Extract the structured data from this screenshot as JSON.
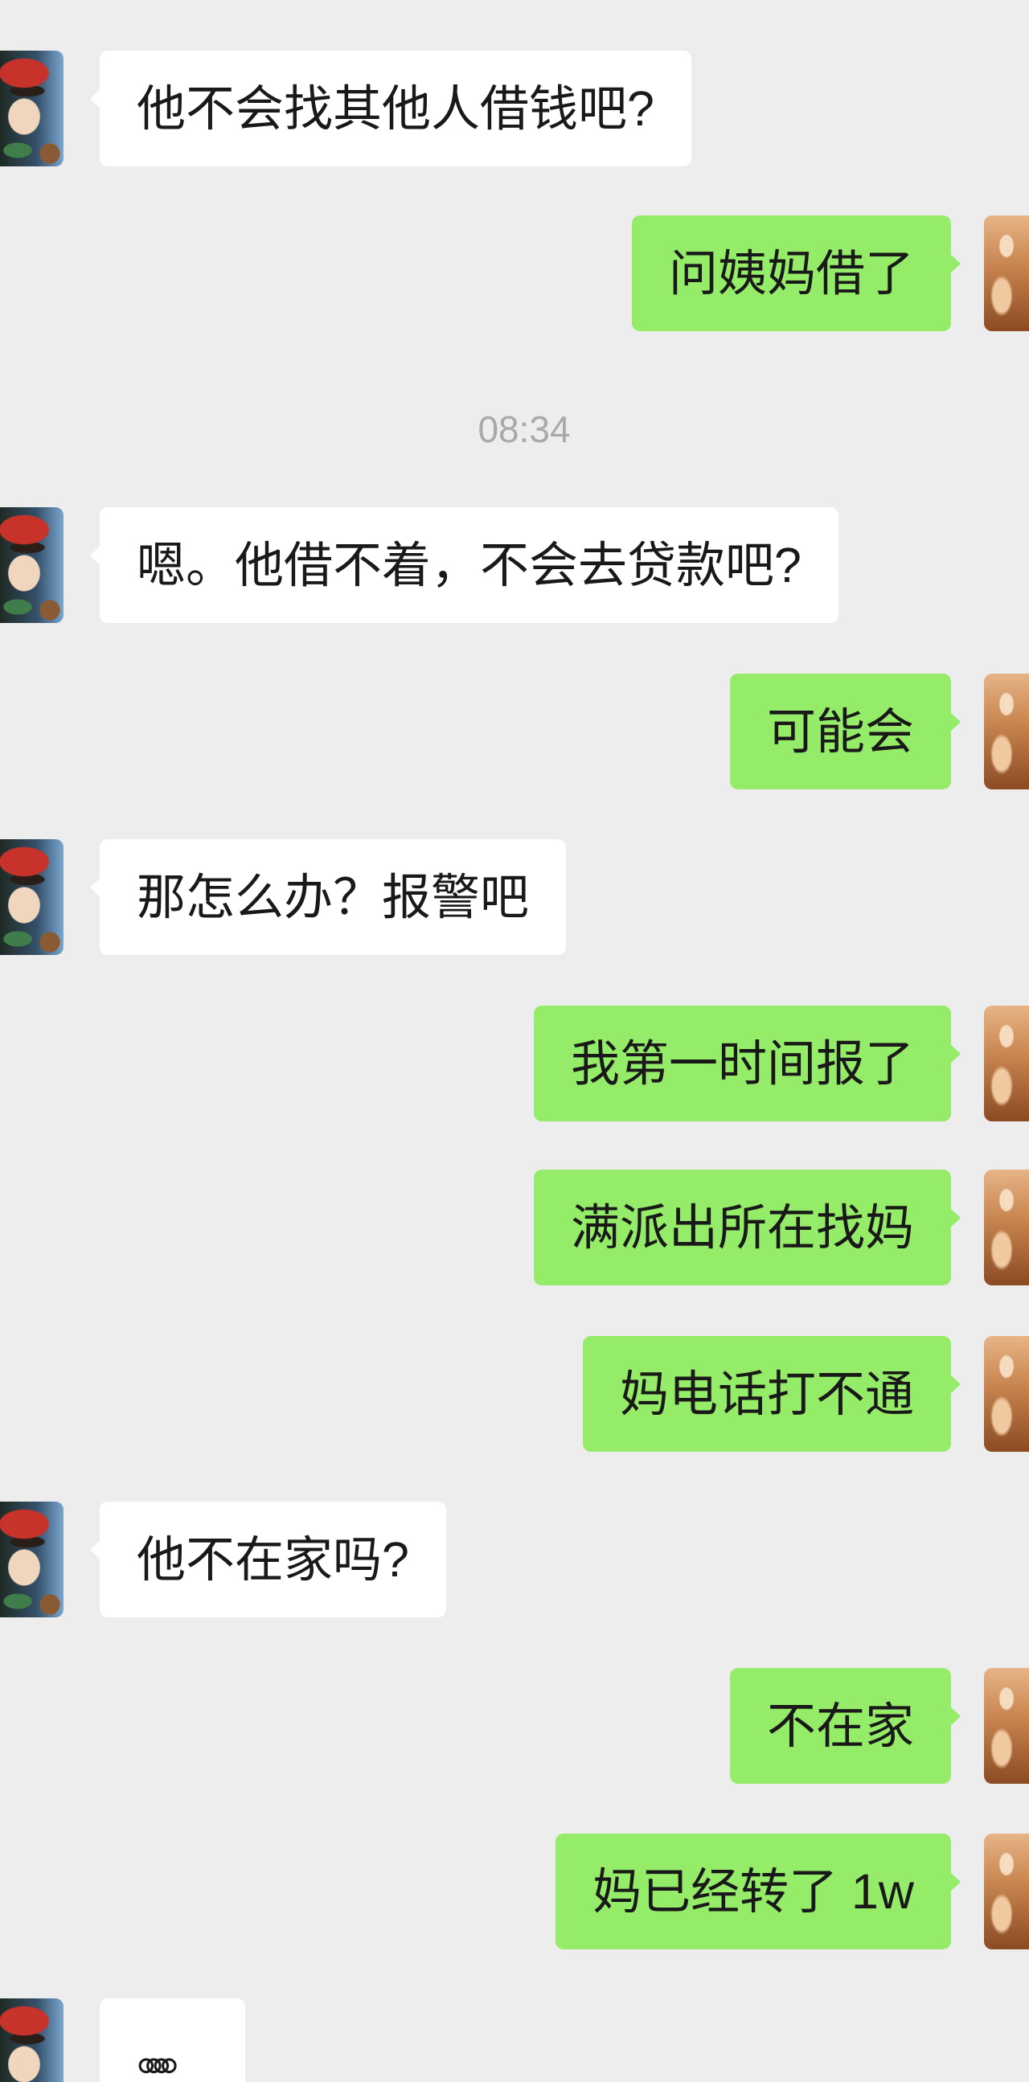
{
  "colors": {
    "background": "#ededed",
    "sent_bubble": "#95ec69",
    "received_bubble": "#ffffff",
    "message_text": "#191919",
    "timestamp": "#a9a9a9"
  },
  "icons": {
    "contact_avatar": "contact-avatar",
    "my_avatar": "my-avatar"
  },
  "timestamp": "08:34",
  "messages": [
    {
      "text": "他不会找其他人借钱吧?",
      "outgoing": false
    },
    {
      "text": "问姨妈借了",
      "outgoing": true
    },
    {
      "text": "嗯。他借不着，不会去贷款吧?",
      "outgoing": false
    },
    {
      "text": "可能会",
      "outgoing": true
    },
    {
      "text": "那怎么办？报警吧",
      "outgoing": false
    },
    {
      "text": "我第一时间报了",
      "outgoing": true
    },
    {
      "text": "满派出所在找妈",
      "outgoing": true
    },
    {
      "text": "妈电话打不通",
      "outgoing": true
    },
    {
      "text": "他不在家吗?",
      "outgoing": false
    },
    {
      "text": "不在家",
      "outgoing": true
    },
    {
      "text": "妈已经转了 1w",
      "outgoing": true
    },
    {
      "text": "。。。。",
      "outgoing": false
    }
  ]
}
